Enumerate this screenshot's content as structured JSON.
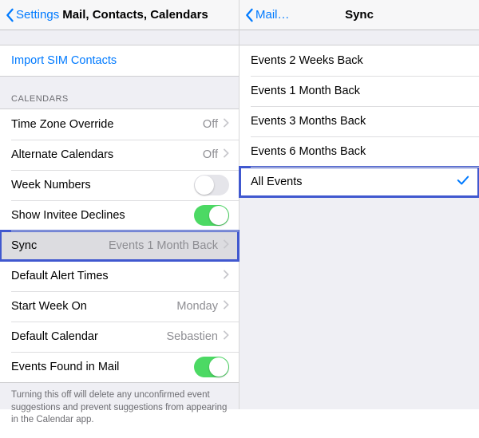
{
  "left": {
    "back_label": "Settings",
    "title": "Mail, Contacts, Calendars",
    "import_sim": "Import SIM Contacts",
    "section_header": "CALENDARS",
    "rows": {
      "timezone": {
        "label": "Time Zone Override",
        "value": "Off"
      },
      "alternate": {
        "label": "Alternate Calendars",
        "value": "Off"
      },
      "week_numbers": {
        "label": "Week Numbers"
      },
      "invitee_declines": {
        "label": "Show Invitee Declines"
      },
      "sync": {
        "label": "Sync",
        "value": "Events 1 Month Back"
      },
      "default_alert": {
        "label": "Default Alert Times"
      },
      "start_week": {
        "label": "Start Week On",
        "value": "Monday"
      },
      "default_calendar": {
        "label": "Default Calendar",
        "value": "Sebastien"
      },
      "events_in_mail": {
        "label": "Events Found in Mail"
      }
    },
    "footer": "Turning this off will delete any unconfirmed event suggestions and prevent suggestions from appearing in the Calendar app."
  },
  "right": {
    "back_label": "Mail…",
    "title": "Sync",
    "options": [
      {
        "label": "Events 2 Weeks Back",
        "selected": false
      },
      {
        "label": "Events 1 Month Back",
        "selected": false
      },
      {
        "label": "Events 3 Months Back",
        "selected": false
      },
      {
        "label": "Events 6 Months Back",
        "selected": false
      },
      {
        "label": "All Events",
        "selected": true
      }
    ]
  }
}
